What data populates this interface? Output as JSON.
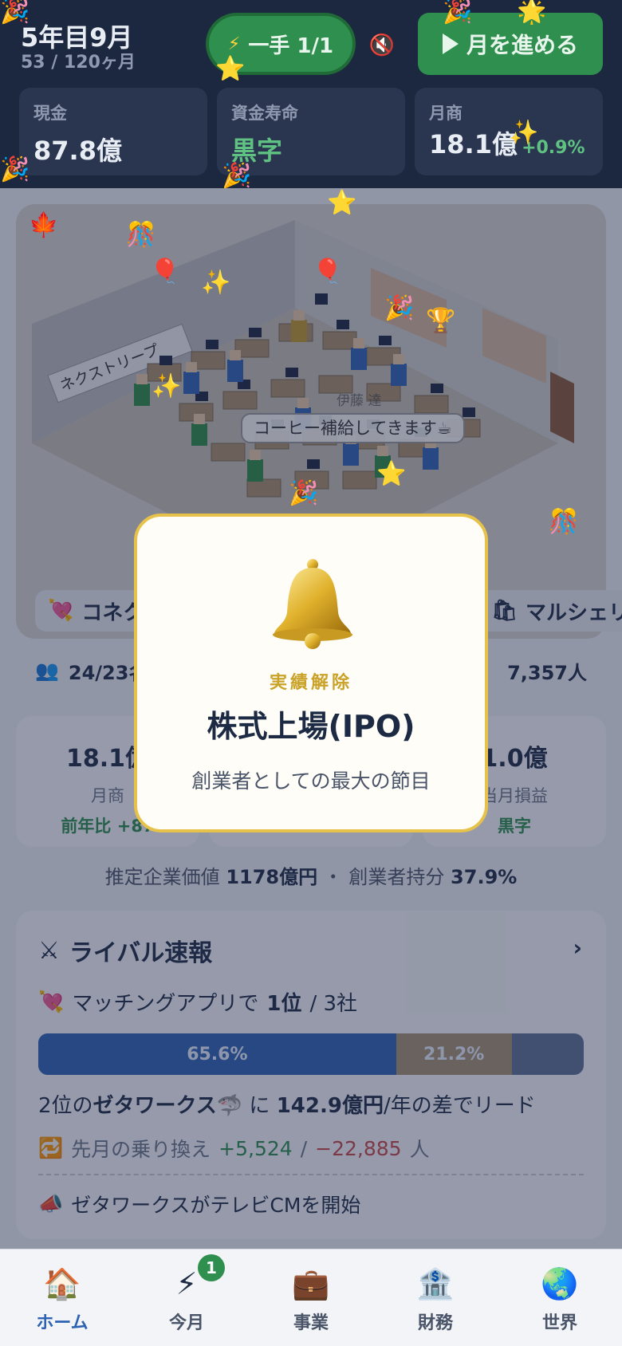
{
  "header": {
    "date_main": "5年目9月",
    "date_sub": "53 / 120ヶ月",
    "action_pill_label": "一手 1/1",
    "advance_label": "月を進める",
    "stats": [
      {
        "label": "現金",
        "value": "87.8億"
      },
      {
        "label": "資金寿命",
        "value": "黒字"
      },
      {
        "label": "月商",
        "value": "18.1億",
        "delta": "+0.9%"
      }
    ]
  },
  "office": {
    "company_sign": "ネクストリープ",
    "employee_name": "伊藤 達",
    "speech_bubble": "コーヒー補給してきます☕"
  },
  "business": {
    "left_chip": "コネク",
    "right_chip": "マルシェリ",
    "employees": "24/23名",
    "users": "7,357人"
  },
  "kpis": [
    {
      "value": "18.1億",
      "label": "月商",
      "sub": "前年比 +87"
    },
    {
      "value": "1.0億",
      "label": "当月損益",
      "sub": "黒字"
    }
  ],
  "valuation": {
    "label": "推定企業価値",
    "value": "1178億円",
    "sep": "・",
    "owner_label": "創業者持分",
    "owner_value": "37.9%"
  },
  "rivals": {
    "title": "ライバル速報",
    "rank_prefix": "マッチングアプリで",
    "rank_value": "1位",
    "rank_suffix": "/ 3社",
    "share_1": 65.6,
    "share_2": 21.2,
    "share_1_label": "65.6%",
    "share_2_label": "21.2%",
    "lead_prefix": "2位の",
    "lead_rival": "ゼタワークス",
    "lead_mid": "に",
    "lead_amount": "142.9億円",
    "lead_suffix": "/年の差でリード",
    "switch_label": "先月の乗り換え",
    "switch_in": "+5,524",
    "switch_sep": "/",
    "switch_out": "−22,885",
    "switch_unit": "人",
    "news": "ゼタワークスがテレビCMを開始"
  },
  "modal": {
    "tag": "実績解除",
    "title": "株式上場(IPO)",
    "desc": "創業者としての最大の節目"
  },
  "nav": {
    "items": [
      {
        "label": "ホーム",
        "icon": "🏠"
      },
      {
        "label": "今月",
        "icon": "⚡"
      },
      {
        "label": "事業",
        "icon": "💼"
      },
      {
        "label": "財務",
        "icon": "🏦"
      },
      {
        "label": "世界",
        "icon": "🌏"
      }
    ],
    "badge": "1"
  },
  "colors": {
    "header_bg": "#1c2740",
    "accent_green": "#2f8f4e",
    "accent_blue": "#2e63b3",
    "gold": "#e7c24a",
    "negative": "#c84a4a"
  }
}
